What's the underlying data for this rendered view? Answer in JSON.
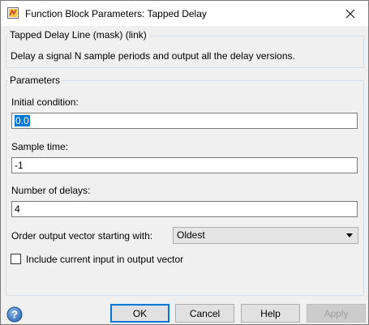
{
  "window": {
    "title": "Function Block Parameters: Tapped Delay",
    "icon": "simulink-block-icon",
    "close_icon": "close-icon"
  },
  "description_group": {
    "title": "Tapped Delay Line (mask) (link)",
    "text": "Delay a signal N sample periods and output all the delay versions."
  },
  "parameters_group": {
    "title": "Parameters",
    "initial_condition": {
      "label": "Initial condition:",
      "value": "0.0"
    },
    "sample_time": {
      "label": "Sample time:",
      "value": "-1"
    },
    "number_of_delays": {
      "label": "Number of delays:",
      "value": "4"
    },
    "order_output": {
      "label": "Order output vector starting with:",
      "selected": "Oldest"
    },
    "include_current": {
      "label": "Include current input in output vector",
      "checked": false
    }
  },
  "buttons": {
    "ok": "OK",
    "cancel": "Cancel",
    "help": "Help",
    "apply": "Apply"
  },
  "colors": {
    "accent": "#0078d7",
    "help_icon": "#2f6cb5"
  }
}
